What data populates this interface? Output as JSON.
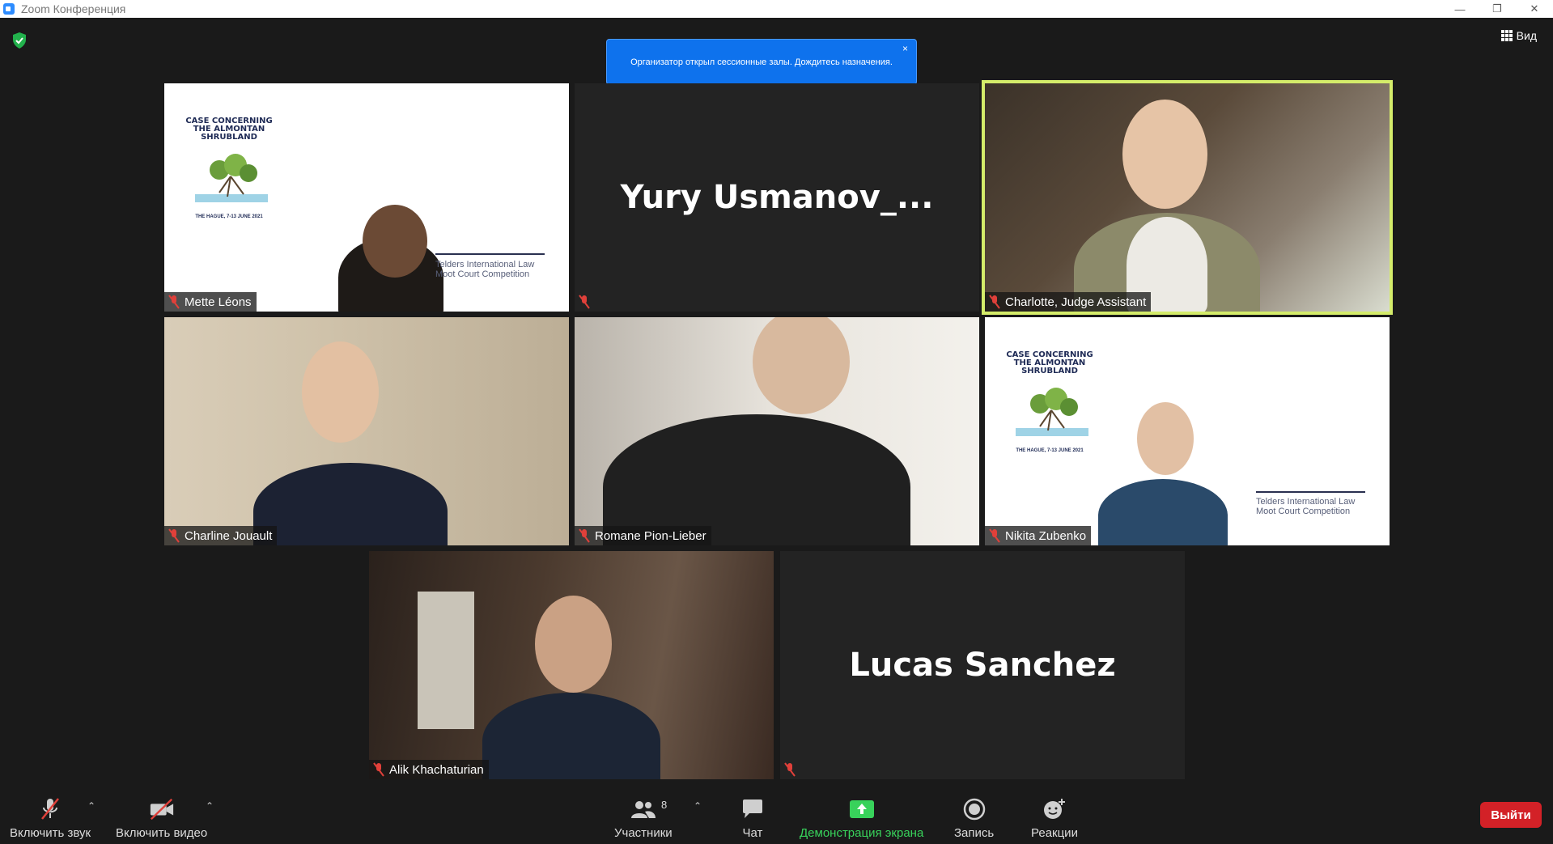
{
  "window": {
    "title": "Zoom Конференция"
  },
  "top": {
    "view_label": "Вид",
    "notice_text": "Организатор открыл сессионные залы. Дождитесь назначения.",
    "notice_close": "×"
  },
  "tiles": {
    "mette": {
      "name": "Mette Léons"
    },
    "yury": {
      "display": "Yury  Usmanov_..."
    },
    "charlotte": {
      "name": "Charlotte, Judge Assistant"
    },
    "charline": {
      "name": "Charline Jouault"
    },
    "romane": {
      "name": "Romane Pion-Lieber"
    },
    "nikita": {
      "name": "Nikita Zubenko"
    },
    "alik": {
      "name": "Alik Khachaturian"
    },
    "lucas": {
      "display": "Lucas Sanchez"
    }
  },
  "poster": {
    "title": "CASE CONCERNING THE ALMONTAN SHRUBLAND",
    "date": "THE HAGUE, 7-13 JUNE 2021",
    "telders": "Telders International Law Moot Court Competition"
  },
  "toolbar": {
    "unmute_label": "Включить звук",
    "video_label": "Включить видео",
    "participants_label": "Участники",
    "participants_count": "8",
    "chat_label": "Чат",
    "share_label": "Демонстрация экрана",
    "record_label": "Запись",
    "reactions_label": "Реакции",
    "leave_label": "Выйти"
  },
  "colors": {
    "accent_blue": "#0e72ed",
    "active_speaker": "#d4ec6a",
    "leave_red": "#d32127",
    "share_green": "#38d25b",
    "mute_red": "#e0403a"
  }
}
